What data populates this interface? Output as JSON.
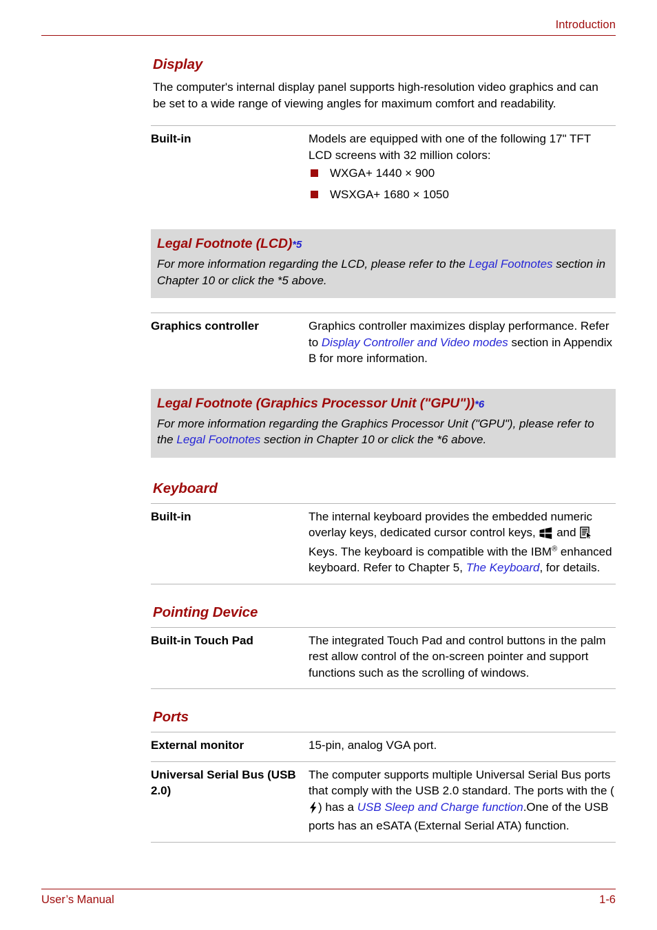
{
  "header": {
    "title": "Introduction"
  },
  "sections": {
    "display": {
      "heading": "Display",
      "intro": "The computer's internal display panel supports high-resolution video graphics and can be set to a wide range of viewing angles for maximum comfort and readability.",
      "rows": [
        {
          "label": "Built-in",
          "value_lead": "Models are equipped with one of the following 17\" TFT LCD screens with 32 million colors:",
          "bullets": [
            "WXGA+ 1440 ×  900",
            "WSXGA+ 1680 × 1050"
          ]
        }
      ],
      "graphics_row": {
        "label": "Graphics controller",
        "text_a": "Graphics controller maximizes display performance. Refer to ",
        "link": "Display Controller and Video modes",
        "text_b": " section in Appendix B for more information."
      }
    },
    "footnote_lcd": {
      "heading": "Legal Footnote (LCD)",
      "ref": "*5",
      "text_a": "For more information regarding the LCD, please refer to the ",
      "link": "Legal Footnotes",
      "text_b": " section in Chapter 10 or click the *5 above."
    },
    "footnote_gpu": {
      "heading": "Legal Footnote (Graphics Processor Unit (\"GPU\"))",
      "ref": "*6",
      "text_a": "For more information regarding the Graphics Processor Unit (\"GPU\"), please refer to the ",
      "link": "Legal Footnotes",
      "text_b": " section in Chapter 10 or click the *6 above."
    },
    "keyboard": {
      "heading": "Keyboard",
      "row": {
        "label": "Built-in",
        "text_a": "The internal keyboard provides the embedded numeric overlay keys, dedicated cursor control keys, ",
        "icon_1": "windows-key-icon",
        "text_b": " and ",
        "icon_2": "application-key-icon",
        "text_c": " Keys. The keyboard is compatible with the IBM",
        "registered": "®",
        "text_d": " enhanced keyboard. Refer to Chapter 5, ",
        "link": "The Keyboard",
        "text_e": ", for details."
      }
    },
    "pointing_device": {
      "heading": "Pointing Device",
      "row": {
        "label": "Built-in Touch Pad",
        "value": "The integrated Touch Pad and control buttons in the palm rest allow control of the on-screen pointer and support functions such as the scrolling of windows."
      }
    },
    "ports": {
      "heading": "Ports",
      "rows": [
        {
          "label": "External monitor",
          "value": "15-pin, analog VGA port."
        }
      ],
      "usb_row": {
        "label": "Universal Serial Bus (USB 2.0)",
        "text_a": "The computer supports multiple Universal Serial Bus ports that comply with the USB 2.0 standard. The ports with the (",
        "icon": "lightning-bolt-icon",
        "text_b": ") has a ",
        "link": "USB Sleep and Charge function",
        "text_c": ".One of the USB ports has an eSATA (External Serial ATA) function."
      }
    }
  },
  "footer": {
    "manual_label": "User’s Manual",
    "page_number": "1-6"
  },
  "colors": {
    "brand_red": "#9e0b0b",
    "link_blue": "#2626d6",
    "callout_gray": "#d9d9d9",
    "rule_gray": "#b6b6b6"
  }
}
